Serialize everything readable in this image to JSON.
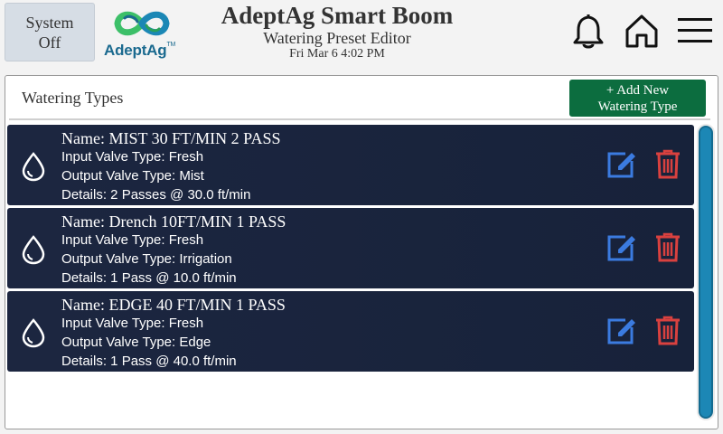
{
  "header": {
    "system_button": {
      "line1": "System",
      "line2": "Off"
    },
    "logo_text": "AdeptAg",
    "logo_tm": "TM",
    "app_title": "AdeptAg Smart Boom",
    "subtitle": "Watering Preset Editor",
    "datetime": "Fri Mar 6 4:02 PM",
    "icons": [
      "bell-icon",
      "home-icon",
      "menu-icon"
    ]
  },
  "panel": {
    "title": "Watering Types",
    "add_button": {
      "line1": "+ Add New",
      "line2": "Watering Type"
    }
  },
  "watering_types": [
    {
      "name": "Name: MIST 30 FT/MIN 2 PASS",
      "input": "Input Valve Type: Fresh",
      "output": "Output Valve Type: Mist",
      "details": "Details: 2 Passes @ 30.0 ft/min"
    },
    {
      "name": "Name: Drench 10FT/MIN 1 PASS",
      "input": "Input Valve Type: Fresh",
      "output": "Output Valve Type: Irrigation",
      "details": "Details: 1 Pass @ 10.0 ft/min"
    },
    {
      "name": "Name: EDGE 40 FT/MIN 1 PASS",
      "input": "Input Valve Type: Fresh",
      "output": "Output Valve Type: Edge",
      "details": "Details: 1 Pass @ 40.0 ft/min"
    }
  ],
  "colors": {
    "card_background": "#1c2640",
    "edit_icon": "#3b7be0",
    "delete_icon": "#d9413f",
    "add_button": "#0c6d3f",
    "scroll_thumb": "#1c87b5",
    "brand_green": "#3cbf68",
    "brand_blue": "#1b6a8f"
  }
}
